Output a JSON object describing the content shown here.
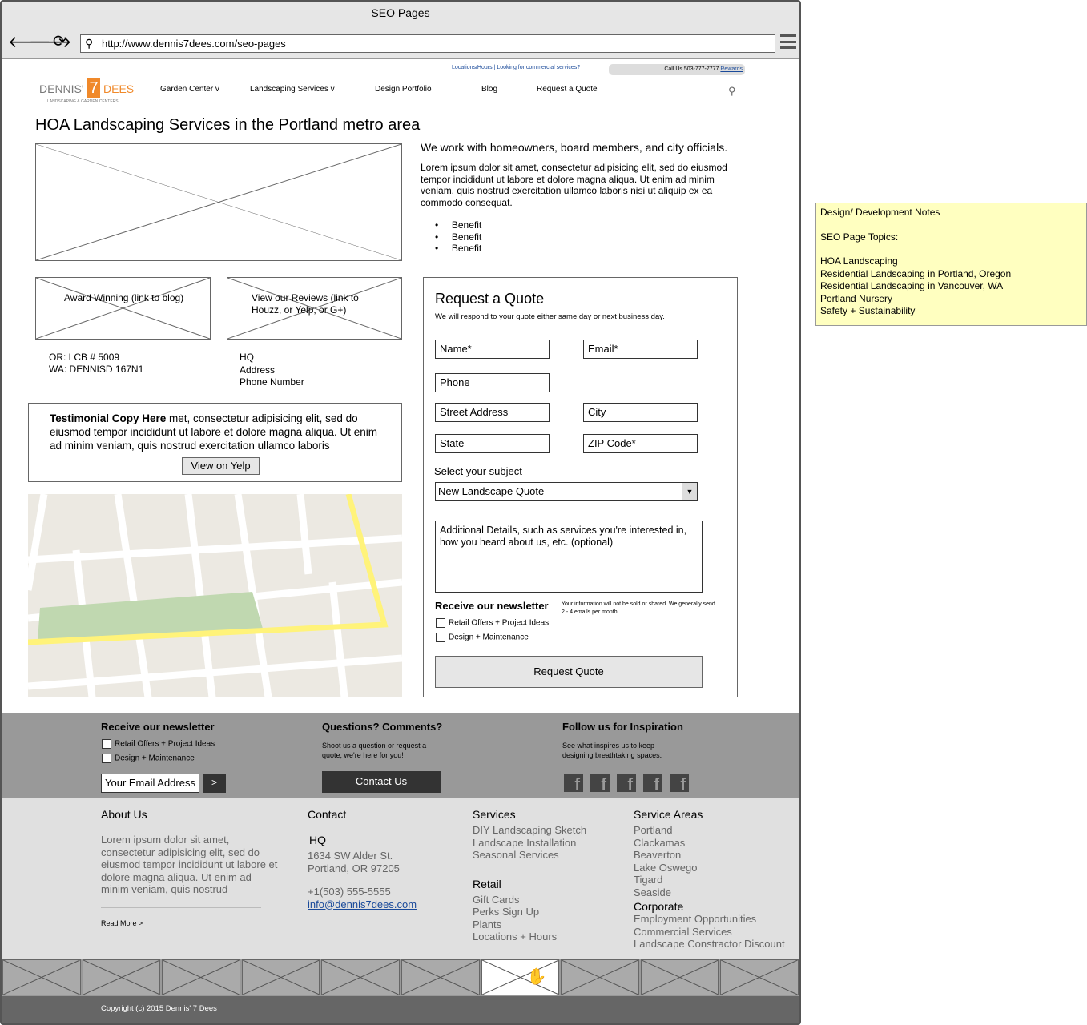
{
  "window": {
    "title": "SEO Pages",
    "url": "http://www.dennis7dees.com/seo-pages"
  },
  "topbar": {
    "locations": "Locations/Hours",
    "sep": "|",
    "commercial": "Looking for commercial services?",
    "call": "Call Us 503-777-7777",
    "rewards": "Rewards"
  },
  "logo": {
    "text": "DENNIS' 7 DEES",
    "tagline": "LANDSCAPING & GARDEN CENTERS"
  },
  "nav": [
    "Garden Center v",
    "Landscaping Services v",
    "Design Portfolio",
    "Blog",
    "Request a Quote"
  ],
  "page_title": "HOA Landscaping Services in the Portland metro area",
  "intro": {
    "lead": "We work with homeowners, board members, and city officials.",
    "body": "Lorem ipsum dolor sit amet, consectetur adipisicing elit, sed do eiusmod tempor incididunt ut labore et dolore magna aliqua. Ut enim ad minim veniam, quis nostrud exercitation ullamco laboris nisi ut aliquip ex ea commodo consequat.",
    "benefits": [
      "Benefit",
      "Benefit",
      "Benefit"
    ]
  },
  "badges": {
    "award": "Award Winning (link to blog)",
    "reviews": "View our Reviews (link to Houzz, or Yelp, or G+)"
  },
  "licenses": {
    "or": "OR: LCB # 5009",
    "wa": "WA: DENNISD 167N1"
  },
  "hq": [
    "HQ",
    "Address",
    "Phone Number"
  ],
  "testimonial": {
    "bold": "Testimonial Copy Here",
    "text": " met, consectetur adipisicing elit, sed do eiusmod tempor incididunt ut labore et dolore magna aliqua. Ut enim ad minim veniam, quis nostrud exercitation ullamco laboris",
    "button": "View on Yelp"
  },
  "quote": {
    "title": "Request a Quote",
    "subtitle": "We will respond to your quote either same day or next business day.",
    "name": "Name*",
    "email": "Email*",
    "phone": "Phone",
    "street": "Street Address",
    "city": "City",
    "state": "State",
    "zip": "ZIP Code*",
    "subject_label": "Select your subject",
    "subject": "New Landscape Quote",
    "details": "Additional Details, such as services you're interested in, how you heard about us, etc. (optional)",
    "newsletter": "Receive our newsletter",
    "privacy": "Your information will not be sold or shared. We generally send 2 - 4 emails per month.",
    "opt1": "Retail Offers + Project Ideas",
    "opt2": "Design + Maintenance",
    "submit": "Request Quote"
  },
  "footer_top": {
    "news_title": "Receive our newsletter",
    "opt1": "Retail Offers + Project Ideas",
    "opt2": "Design + Maintenance",
    "email_placeholder": "Your Email Address",
    "go": ">",
    "q_title": "Questions? Comments?",
    "q_text": "Shoot us a question or request a quote, we're here for you!",
    "contact": "Contact Us",
    "follow_title": "Follow us for Inspiration",
    "follow_text": "See what inspires us to keep designing breathtaking spaces."
  },
  "footer": {
    "about_title": "About Us",
    "about_text": "Lorem ipsum dolor sit amet, consectetur adipisicing elit, sed do eiusmod tempor incididunt ut labore et dolore magna aliqua. Ut enim ad minim veniam, quis nostrud",
    "read_more": "Read More >",
    "contact_title": "Contact",
    "hq": "HQ",
    "addr1": "1634 SW Alder St.",
    "addr2": "Portland, OR 97205",
    "phone": "+1(503) 555-5555",
    "email": "info@dennis7dees.com",
    "services_title": "Services",
    "services": [
      "DIY Landscaping Sketch",
      "Landscape Installation",
      "Seasonal Services"
    ],
    "retail_title": "Retail",
    "retail": [
      "Gift Cards",
      "Perks Sign Up",
      "Plants",
      "Locations + Hours"
    ],
    "areas_title": "Service Areas",
    "areas": [
      "Portland",
      "Clackamas",
      "Beaverton",
      "Lake Oswego",
      "Tigard",
      "Seaside"
    ],
    "corp_title": "Corporate",
    "corp": [
      "Employment Opportunities",
      "Commercial Services",
      "Landscape Constractor Discount"
    ]
  },
  "copyright": "Copyright (c) 2015 Dennis' 7 Dees",
  "notes": {
    "title": "Design/ Development Notes",
    "topics_label": "SEO Page Topics:",
    "topics": [
      "HOA Landscaping",
      "Residential Landscaping in Portland, Oregon",
      "Residential Landscaping in Vancouver, WA",
      "Portland Nursery",
      "Safety + Sustainability"
    ]
  },
  "colors": {
    "orange": "#f0892a",
    "footer_top": "#999999",
    "footer": "#e0e0e0",
    "copyright_bar": "#666666",
    "note": "#ffffc0",
    "map_road_yellow": "#fff37a",
    "map_park": "#c0d8b0"
  }
}
